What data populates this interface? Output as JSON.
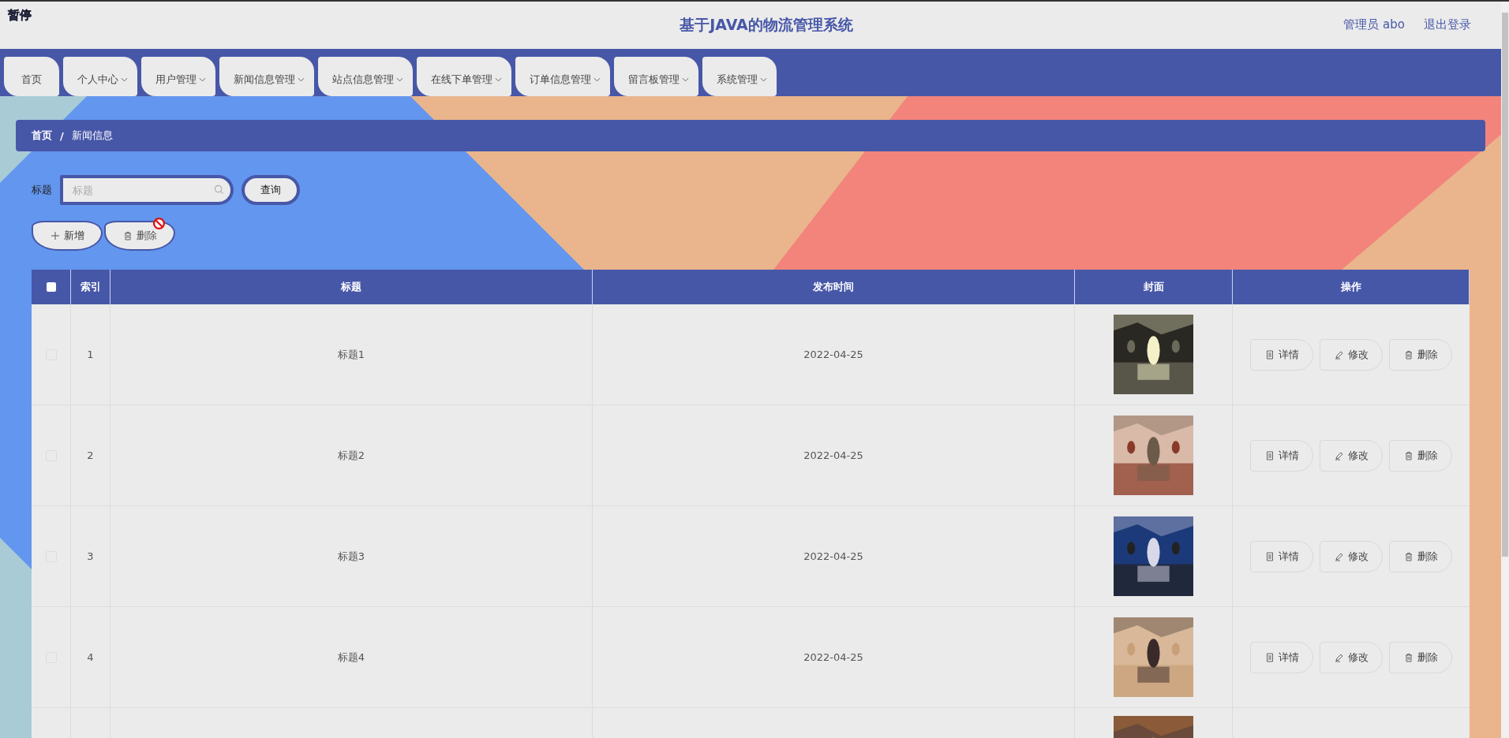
{
  "overlay_label": "暂停",
  "header": {
    "title": "基于JAVA的物流管理系统",
    "user": "管理员 abo",
    "logout": "退出登录"
  },
  "nav": [
    {
      "label": "首页",
      "dropdown": false
    },
    {
      "label": "个人中心",
      "dropdown": true
    },
    {
      "label": "用户管理",
      "dropdown": true
    },
    {
      "label": "新闻信息管理",
      "dropdown": true
    },
    {
      "label": "站点信息管理",
      "dropdown": true
    },
    {
      "label": "在线下单管理",
      "dropdown": true
    },
    {
      "label": "订单信息管理",
      "dropdown": true
    },
    {
      "label": "留言板管理",
      "dropdown": true
    },
    {
      "label": "系统管理",
      "dropdown": true
    }
  ],
  "breadcrumb": {
    "items": [
      "首页",
      "新闻信息"
    ],
    "separator": "/"
  },
  "search": {
    "label": "标题",
    "placeholder": "标题",
    "button": "查询"
  },
  "actions": [
    {
      "kind": "add",
      "label": "新增",
      "disabled": false
    },
    {
      "kind": "delete",
      "label": "删除",
      "disabled": true
    }
  ],
  "table": {
    "select_all_checked": false,
    "columns": [
      "索引",
      "标题",
      "发布时间",
      "封面",
      "操作"
    ],
    "rows": [
      {
        "checked": false,
        "index": "1",
        "title": "标题1",
        "date": "2022-04-25",
        "cover": {
          "kind": "picture"
        },
        "buttons": [
          {
            "kind": "detail",
            "label": "详情"
          },
          {
            "kind": "edit",
            "label": "修改"
          },
          {
            "kind": "delete",
            "label": "删除"
          }
        ]
      },
      {
        "checked": false,
        "index": "2",
        "title": "标题2",
        "date": "2022-04-25",
        "cover": {
          "kind": "picture"
        },
        "buttons": [
          {
            "kind": "detail",
            "label": "详情"
          },
          {
            "kind": "edit",
            "label": "修改"
          },
          {
            "kind": "delete",
            "label": "删除"
          }
        ]
      },
      {
        "checked": false,
        "index": "3",
        "title": "标题3",
        "date": "2022-04-25",
        "cover": {
          "kind": "picture"
        },
        "buttons": [
          {
            "kind": "detail",
            "label": "详情"
          },
          {
            "kind": "edit",
            "label": "修改"
          },
          {
            "kind": "delete",
            "label": "删除"
          }
        ]
      },
      {
        "checked": false,
        "index": "4",
        "title": "标题4",
        "date": "2022-04-25",
        "cover": {
          "kind": "picture"
        },
        "buttons": [
          {
            "kind": "detail",
            "label": "详情"
          },
          {
            "kind": "edit",
            "label": "修改"
          },
          {
            "kind": "delete",
            "label": "删除"
          }
        ]
      },
      {
        "cover": {
          "kind": "picture"
        }
      }
    ]
  }
}
